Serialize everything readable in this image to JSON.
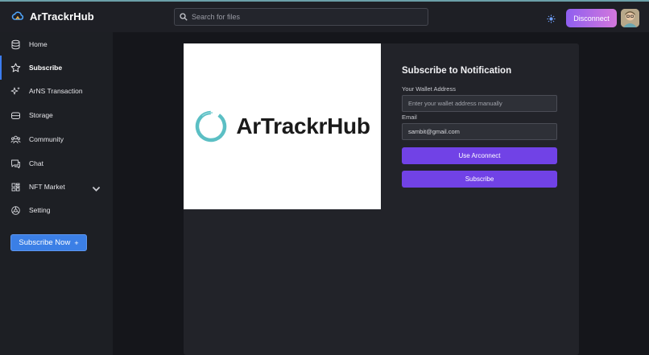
{
  "app": {
    "name": "ArTrackrHub"
  },
  "header": {
    "search_placeholder": "Search for files",
    "disconnect_label": "Disconnect",
    "theme_icon": "sun-icon",
    "accent": "#7a5ff0"
  },
  "sidebar": {
    "items": [
      {
        "label": "Home",
        "icon": "database-icon"
      },
      {
        "label": "Subscribe",
        "icon": "star-icon",
        "active": true
      },
      {
        "label": "ArNS Transaction",
        "icon": "sparkles-icon"
      },
      {
        "label": "Storage",
        "icon": "storage-icon"
      },
      {
        "label": "Community",
        "icon": "community-icon"
      },
      {
        "label": "Chat",
        "icon": "chat-icon"
      },
      {
        "label": "NFT Market",
        "icon": "grid-icon",
        "has_dropdown": true
      },
      {
        "label": "Setting",
        "icon": "settings-icon"
      }
    ],
    "cta_label": "Subscribe Now",
    "cta_icon": "+",
    "active_color": "#3b7cf0"
  },
  "main": {
    "logo_text": "ArTrackrHub",
    "form": {
      "title": "Subscribe to Notification",
      "wallet_label": "Your Wallet Address",
      "wallet_placeholder": "Enter your wallet address manually",
      "email_label": "Email",
      "email_value": "sambit@gmail.com",
      "arconnect_label": "Use Arconnect",
      "subscribe_label": "Subscribe",
      "button_color": "#7142e6"
    }
  }
}
